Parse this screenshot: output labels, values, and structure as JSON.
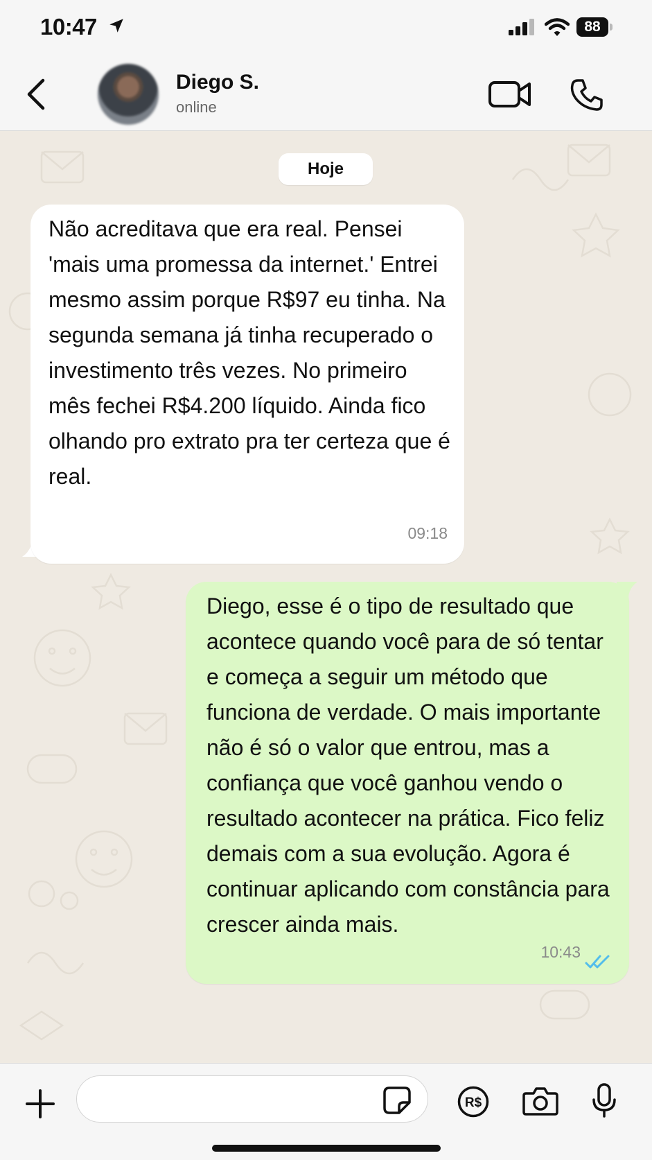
{
  "status_bar": {
    "time": "10:47",
    "battery": "88"
  },
  "header": {
    "contact_name": "Diego S.",
    "contact_status": "online"
  },
  "chat": {
    "date_label": "Hoje",
    "messages": [
      {
        "direction": "incoming",
        "text": "Não acreditava que era real. Pensei 'mais uma promessa da internet.' Entrei mesmo assim porque R$97 eu tinha. Na segunda semana já tinha recuperado o investimento três vezes. No primeiro mês fechei R$4.200 líquido. Ainda fico olhando pro extrato pra ter certeza que é real.",
        "time": "09:18"
      },
      {
        "direction": "outgoing",
        "text": "Diego, esse é o tipo de resultado que acontece quando você para de só tentar e começa a seguir um método que funciona de verdade. O mais importante não é só o valor que entrou, mas a confiança que você ganhou vendo o resultado acontecer na prática. Fico feliz demais com a sua evolução. Agora é continuar aplicando com constância para crescer ainda mais.",
        "time": "10:43",
        "status": "read"
      }
    ]
  },
  "input_bar": {
    "placeholder": "",
    "value": ""
  },
  "colors": {
    "incoming_bubble": "#ffffff",
    "outgoing_bubble": "#dcf8c6",
    "chat_background": "#efeae2",
    "read_ticks": "#53bdeb"
  },
  "icons": [
    "location-arrow-icon",
    "signal-icon",
    "wifi-icon",
    "back-chevron-icon",
    "video-call-icon",
    "phone-icon",
    "plus-icon",
    "sticker-icon",
    "pix-icon",
    "camera-icon",
    "microphone-icon",
    "double-check-icon"
  ]
}
